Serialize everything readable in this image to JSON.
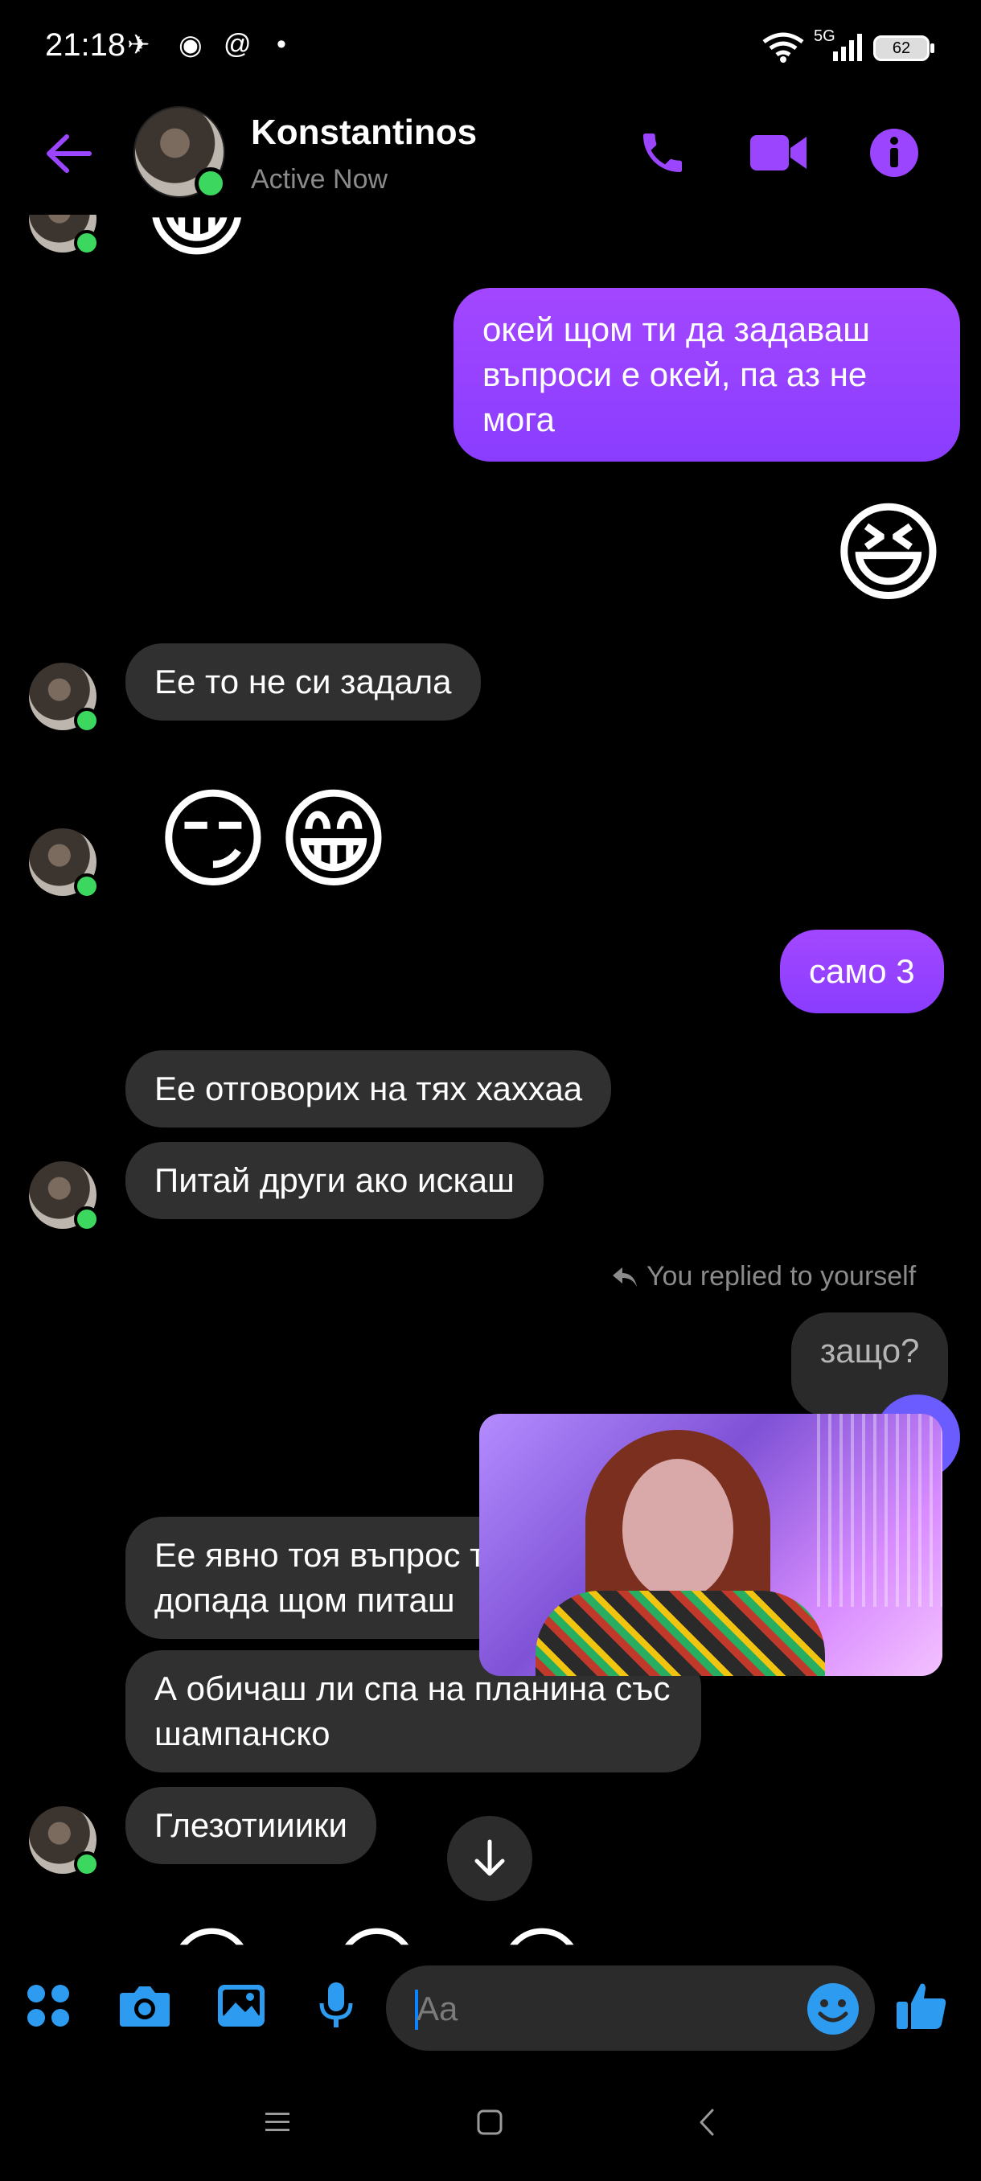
{
  "status_bar": {
    "time": "21:18",
    "network": "5G",
    "battery": "62"
  },
  "header": {
    "name": "Konstantinos",
    "status": "Active Now"
  },
  "messages": {
    "out_1": "окей щом ти да задаваш въпроси е окей, па аз не мога",
    "out_1_emoji": "😆",
    "in_1": "Ее то не си задала",
    "in_2_emoji_a": "😏",
    "in_2_emoji_b": "😁",
    "out_2": "само 3",
    "in_3": "Ее отговорих на тях хаххаа",
    "in_4": "Питай други ако искаш",
    "reply_note": "You replied to yourself",
    "out_3": "защо?",
    "in_5": "Ее явно тоя въпрос ти допада щом питаш",
    "in_6": "А обичаш ли спа на планина със шампанско",
    "in_7": "Глезотииики",
    "partial_emojis": "😁 😁 😁"
  },
  "composer": {
    "placeholder": "Aa"
  },
  "colors": {
    "accent": "#9b45ff",
    "blue": "#2d9bf0",
    "online": "#3bd75f"
  }
}
